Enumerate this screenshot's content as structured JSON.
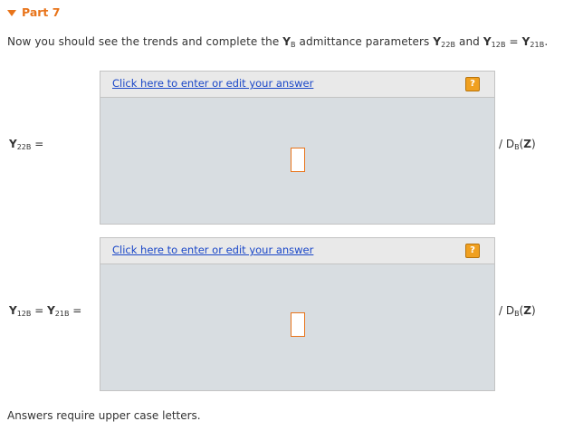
{
  "part": {
    "label": "Part 7"
  },
  "prompt": {
    "t1": "Now you should see the trends and complete the ",
    "y": "Y",
    "b": "B",
    "t2": " admittance parameters ",
    "y22b_sub": "22B",
    "t3": " and ",
    "y12b_sub": "12B",
    "eq": " = ",
    "y21b_sub": "21B",
    "end": "."
  },
  "answers": [
    {
      "label_sub": "22B",
      "equals": " =",
      "link": "Click here to enter or edit your answer",
      "help": "?",
      "suffix": "/ D",
      "suffix_sub": "B",
      "suffix_paren_open": "(",
      "suffix_var": "Z",
      "suffix_paren_close": ")"
    },
    {
      "label_sub": "12B",
      "mid": " = ",
      "label_sub2": "21B",
      "equals": " =",
      "link": "Click here to enter or edit your answer",
      "help": "?",
      "suffix": "/ D",
      "suffix_sub": "B",
      "suffix_paren_open": "(",
      "suffix_var": "Z",
      "suffix_paren_close": ")"
    }
  ],
  "footer": "Answers require upper case letters.",
  "colors": {
    "accent": "#e8741a",
    "link": "#1a47c8",
    "box_bg": "#d8dde1",
    "bar_bg": "#e9e9e9"
  }
}
